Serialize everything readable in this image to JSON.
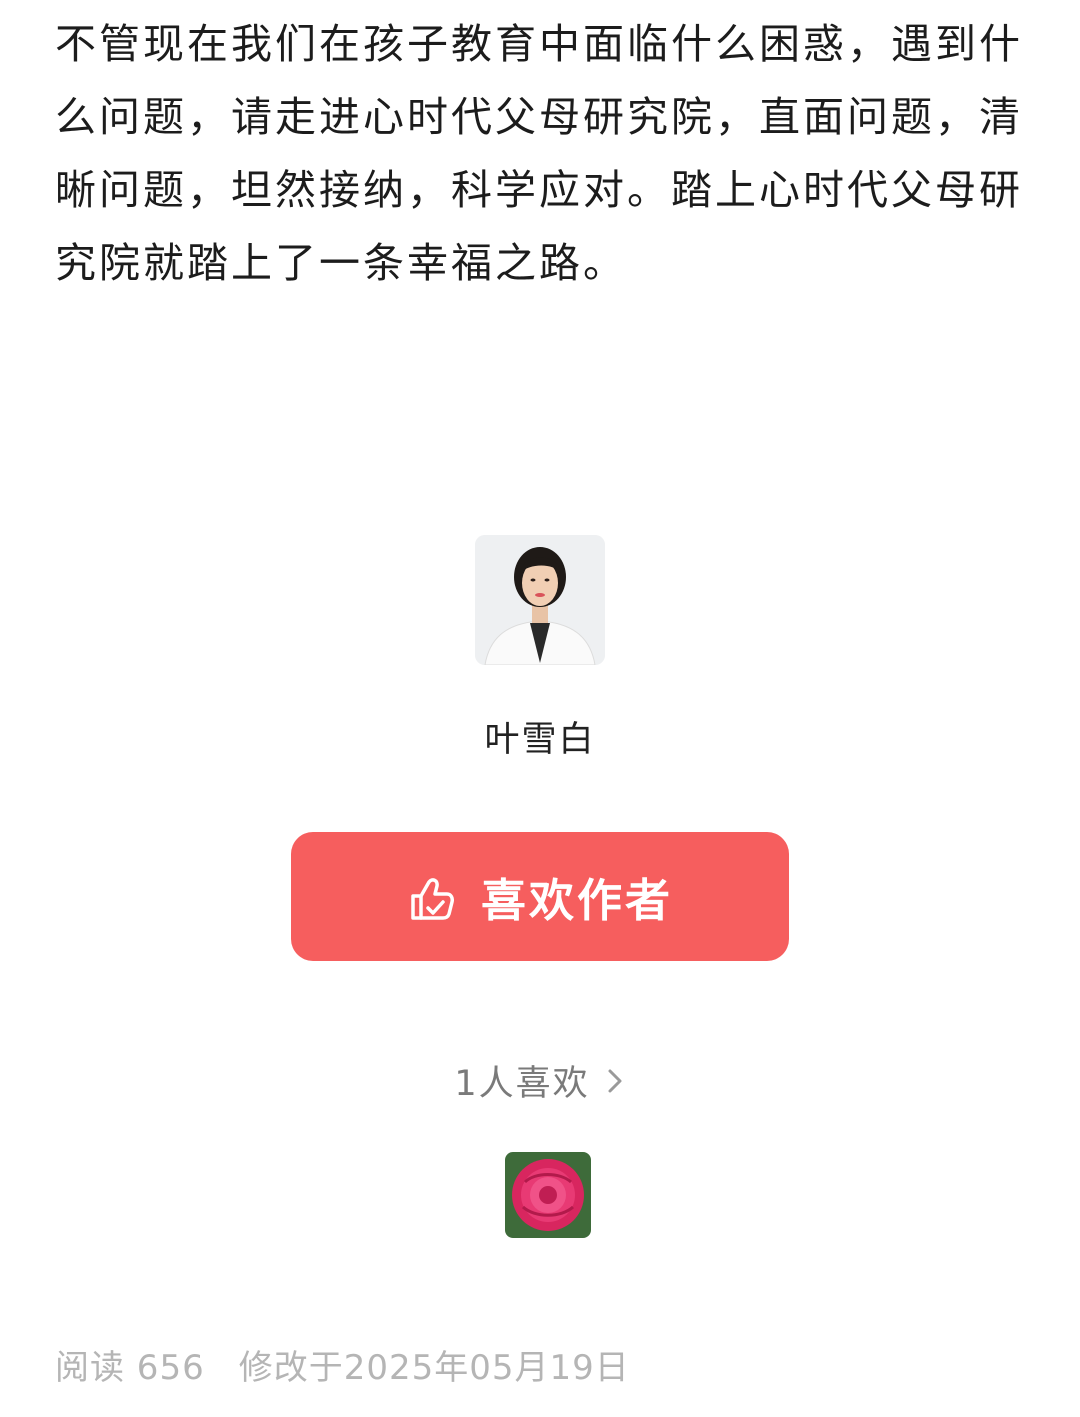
{
  "article": {
    "paragraph": "不管现在我们在孩子教育中面临什么困惑，遇到什么问题，请走进心时代父母研究院，直面问题，清晰问题，坦然接纳，科学应对。踏上心时代父母研究院就踏上了一条幸福之路。"
  },
  "author": {
    "name": "叶雪白",
    "like_button_label": "喜欢作者",
    "like_count_text": "1人喜欢"
  },
  "footer": {
    "read_count": "阅读 656",
    "modified": "修改于2025年05月19日"
  },
  "icons": {
    "like": "thumbs-up-icon",
    "chevron": "chevron-right-icon"
  },
  "colors": {
    "accent": "#f65e5e",
    "muted_text": "#b5b5b5"
  }
}
